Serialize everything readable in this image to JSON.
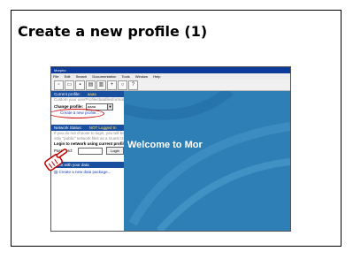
{
  "slide": {
    "title": "Create a new profile (1)"
  },
  "app": {
    "window_title": "Morpho",
    "menu": [
      "File",
      "Edit",
      "Search",
      "Documentation",
      "Tools",
      "Window",
      "Help"
    ],
    "profile_section": {
      "header": "Current profile:",
      "header_value": "aaaa",
      "description": "Custom your userProfile/datafilesformatary pressor",
      "change_label": "Change profile:",
      "selected_profile": "aaaa",
      "create_link": "Create a new profile..."
    },
    "network_section": {
      "header": "Network Status:",
      "header_value": "NOT Logged In",
      "note_line1": "If you do not choose to login, you will be able to access",
      "note_line2": "only \"public\" network files as a Guest User.",
      "login_title": "Login to network using current profile:",
      "password_label": "Password:",
      "login_button": "Login"
    },
    "work_section": {
      "header": "Work with your data",
      "action_label": "Create a new data package..."
    },
    "welcome_text": "Welcome to Mor"
  }
}
